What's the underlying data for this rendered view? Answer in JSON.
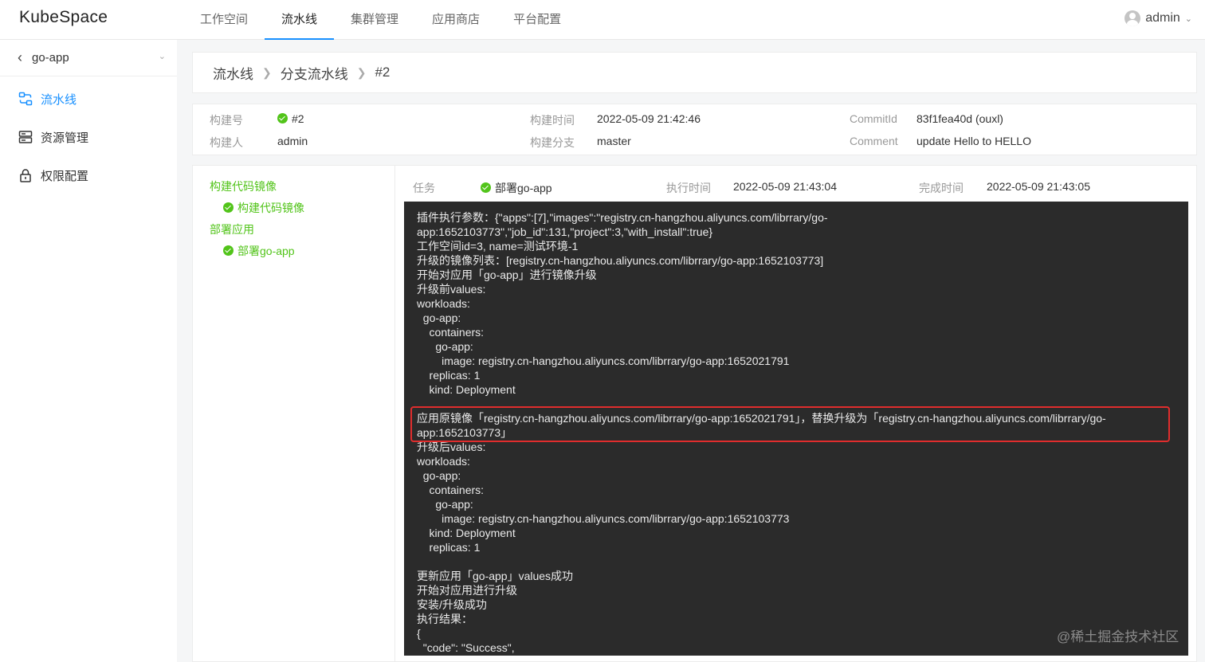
{
  "app": {
    "logo": "KubeSpace"
  },
  "nav": {
    "items": [
      {
        "label": "工作空间"
      },
      {
        "label": "流水线"
      },
      {
        "label": "集群管理"
      },
      {
        "label": "应用商店"
      },
      {
        "label": "平台配置"
      }
    ],
    "active_index": 1
  },
  "user": {
    "name": "admin"
  },
  "sidebar": {
    "project": "go-app",
    "items": [
      {
        "label": "流水线",
        "icon": "pipeline-icon",
        "active": true
      },
      {
        "label": "资源管理",
        "icon": "server-icon",
        "active": false
      },
      {
        "label": "权限配置",
        "icon": "lock-icon",
        "active": false
      }
    ]
  },
  "breadcrumb": [
    "流水线",
    "分支流水线",
    "#2"
  ],
  "build_info": {
    "build_no_label": "构建号",
    "build_no": "#2",
    "builder_label": "构建人",
    "builder": "admin",
    "build_time_label": "构建时间",
    "build_time": "2022-05-09 21:42:46",
    "branch_label": "构建分支",
    "branch": "master",
    "commit_label": "CommitId",
    "commit": "83f1fea40d (ouxl)",
    "comment_label": "Comment",
    "comment": "update Hello to HELLO"
  },
  "stages": [
    {
      "name": "构建代码镜像",
      "steps": [
        "构建代码镜像"
      ]
    },
    {
      "name": "部署应用",
      "steps": [
        "部署go-app"
      ]
    }
  ],
  "task": {
    "task_label": "任务",
    "task": "部署go-app",
    "exec_label": "执行时间",
    "exec_time": "2022-05-09 21:43:04",
    "done_label": "完成时间",
    "done_time": "2022-05-09 21:43:05"
  },
  "log_lines": [
    "插件执行参数：{\"apps\":[7],\"images\":\"registry.cn-hangzhou.aliyuncs.com/librrary/go-",
    "app:1652103773\",\"job_id\":131,\"project\":3,\"with_install\":true}",
    "工作空间id=3, name=测试环境-1",
    "升级的镜像列表：[registry.cn-hangzhou.aliyuncs.com/librrary/go-app:1652103773]",
    "开始对应用「go-app」进行镜像升级",
    "升级前values:",
    "workloads:",
    "  go-app:",
    "    containers:",
    "      go-app:",
    "        image: registry.cn-hangzhou.aliyuncs.com/librrary/go-app:1652021791",
    "    replicas: 1",
    "    kind: Deployment",
    "",
    "应用原镜像「registry.cn-hangzhou.aliyuncs.com/librrary/go-app:1652021791」，替换升级为「registry.cn-hangzhou.aliyuncs.com/librrary/go-",
    "app:1652103773」",
    "升级后values:",
    "workloads:",
    "  go-app:",
    "    containers:",
    "      go-app:",
    "        image: registry.cn-hangzhou.aliyuncs.com/librrary/go-app:1652103773",
    "    kind: Deployment",
    "    replicas: 1",
    "",
    "更新应用「go-app」values成功",
    "开始对应用进行升级",
    "安装/升级成功",
    "执行结果：",
    "{",
    "  \"code\": \"Success\","
  ],
  "watermark": "@稀土掘金技术社区",
  "colors": {
    "accent": "#1890ff",
    "success": "#52c41a",
    "log_bg": "#2b2b2b",
    "highlight": "#e02d2d"
  }
}
